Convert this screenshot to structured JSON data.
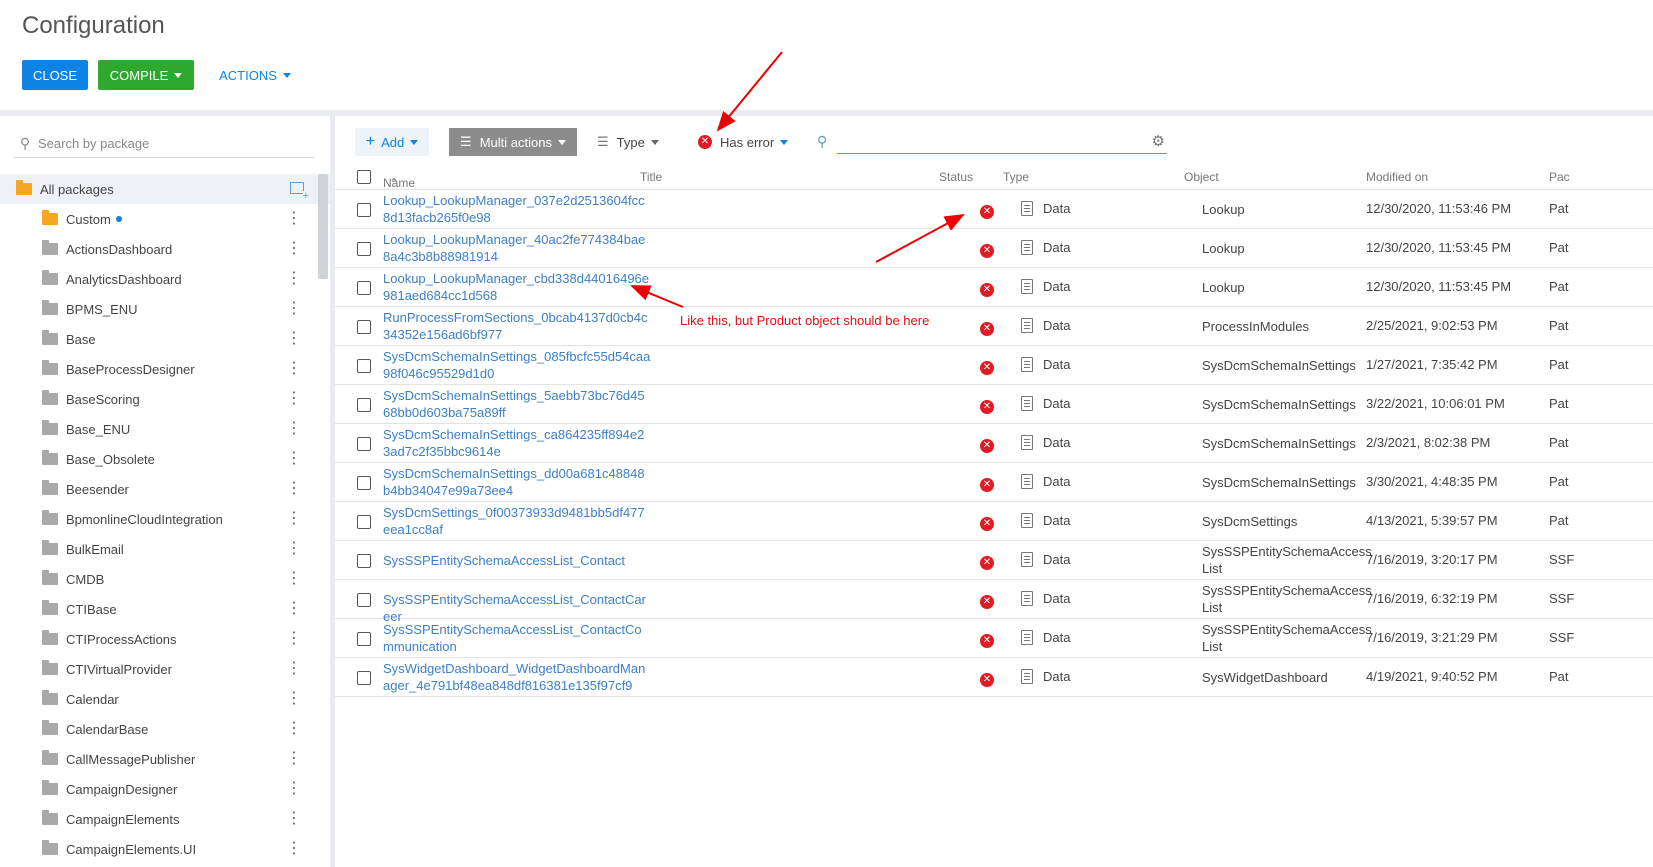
{
  "header": {
    "title": "Configuration",
    "close_label": "CLOSE",
    "compile_label": "COMPILE",
    "actions_label": "ACTIONS"
  },
  "sidebar": {
    "search_placeholder": "Search by package",
    "all_packages": "All packages",
    "packages": [
      {
        "label": "Custom"
      },
      {
        "label": "ActionsDashboard"
      },
      {
        "label": "AnalyticsDashboard"
      },
      {
        "label": "BPMS_ENU"
      },
      {
        "label": "Base"
      },
      {
        "label": "BaseProcessDesigner"
      },
      {
        "label": "BaseScoring"
      },
      {
        "label": "Base_ENU"
      },
      {
        "label": "Base_Obsolete"
      },
      {
        "label": "Beesender"
      },
      {
        "label": "BpmonlineCloudIntegration"
      },
      {
        "label": "BulkEmail"
      },
      {
        "label": "CMDB"
      },
      {
        "label": "CTIBase"
      },
      {
        "label": "CTIProcessActions"
      },
      {
        "label": "CTIVirtualProvider"
      },
      {
        "label": "Calendar"
      },
      {
        "label": "CalendarBase"
      },
      {
        "label": "CallMessagePublisher"
      },
      {
        "label": "CampaignDesigner"
      },
      {
        "label": "CampaignElements"
      },
      {
        "label": "CampaignElements.UI"
      }
    ]
  },
  "toolbar": {
    "add_label": "Add",
    "multi_actions_label": "Multi actions",
    "type_label": "Type",
    "has_error_label": "Has error",
    "search_value": ""
  },
  "table": {
    "headers": {
      "name": "Name",
      "title": "Title",
      "status": "Status",
      "type": "Type",
      "object": "Object",
      "modified": "Modified on",
      "package": "Pac"
    },
    "rows": [
      {
        "name": "Lookup_LookupManager_037e2d2513604fcc8d13facb265f0e98",
        "type": "Data",
        "object": "Lookup",
        "modified": "12/30/2020, 11:53:46 PM",
        "package": "Pat"
      },
      {
        "name": "Lookup_LookupManager_40ac2fe774384bae8a4c3b8b88981914",
        "type": "Data",
        "object": "Lookup",
        "modified": "12/30/2020, 11:53:45 PM",
        "package": "Pat"
      },
      {
        "name": "Lookup_LookupManager_cbd338d44016496e981aed684cc1d568",
        "type": "Data",
        "object": "Lookup",
        "modified": "12/30/2020, 11:53:45 PM",
        "package": "Pat"
      },
      {
        "name": "RunProcessFromSections_0bcab4137d0cb4c34352e156ad6bf977",
        "type": "Data",
        "object": "ProcessInModules",
        "modified": "2/25/2021, 9:02:53 PM",
        "package": "Pat"
      },
      {
        "name": "SysDcmSchemaInSettings_085fbcfc55d54caa98f046c95529d1d0",
        "type": "Data",
        "object": "SysDcmSchemaInSettings",
        "modified": "1/27/2021, 7:35:42 PM",
        "package": "Pat"
      },
      {
        "name": "SysDcmSchemaInSettings_5aebb73bc76d4568bb0d603ba75a89ff",
        "type": "Data",
        "object": "SysDcmSchemaInSettings",
        "modified": "3/22/2021, 10:06:01 PM",
        "package": "Pat"
      },
      {
        "name": "SysDcmSchemaInSettings_ca864235ff894e23ad7c2f35bbc9614e",
        "type": "Data",
        "object": "SysDcmSchemaInSettings",
        "modified": "2/3/2021, 8:02:38 PM",
        "package": "Pat"
      },
      {
        "name": "SysDcmSchemaInSettings_dd00a681c48848b4bb34047e99a73ee4",
        "type": "Data",
        "object": "SysDcmSchemaInSettings",
        "modified": "3/30/2021, 4:48:35 PM",
        "package": "Pat"
      },
      {
        "name": "SysDcmSettings_0f00373933d9481bb5df477eea1cc8af",
        "type": "Data",
        "object": "SysDcmSettings",
        "modified": "4/13/2021, 5:39:57 PM",
        "package": "Pat"
      },
      {
        "name": "SysSSPEntitySchemaAccessList_Contact",
        "type": "Data",
        "object": "SysSSPEntitySchemaAccessList",
        "modified": "7/16/2019, 3:20:17 PM",
        "package": "SSF"
      },
      {
        "name": "SysSSPEntitySchemaAccessList_ContactCareer",
        "type": "Data",
        "object": "SysSSPEntitySchemaAccessList",
        "modified": "7/16/2019, 6:32:19 PM",
        "package": "SSF"
      },
      {
        "name": "SysSSPEntitySchemaAccessList_ContactCommunication",
        "type": "Data",
        "object": "SysSSPEntitySchemaAccessList",
        "modified": "7/16/2019, 3:21:29 PM",
        "package": "SSF"
      },
      {
        "name": "SysWidgetDashboard_WidgetDashboardManager_4e791bf48ea848df816381e135f97cf9",
        "type": "Data",
        "object": "SysWidgetDashboard",
        "modified": "4/19/2021, 9:40:52 PM",
        "package": "Pat"
      }
    ]
  },
  "annotation": {
    "text": "Like this, but Product object should be here",
    "color": "#dd1111"
  },
  "colors": {
    "primary_blue": "#0d84e5",
    "compile_green": "#2fa830",
    "error_red": "#e21a23",
    "link_blue": "#3d80c7"
  }
}
